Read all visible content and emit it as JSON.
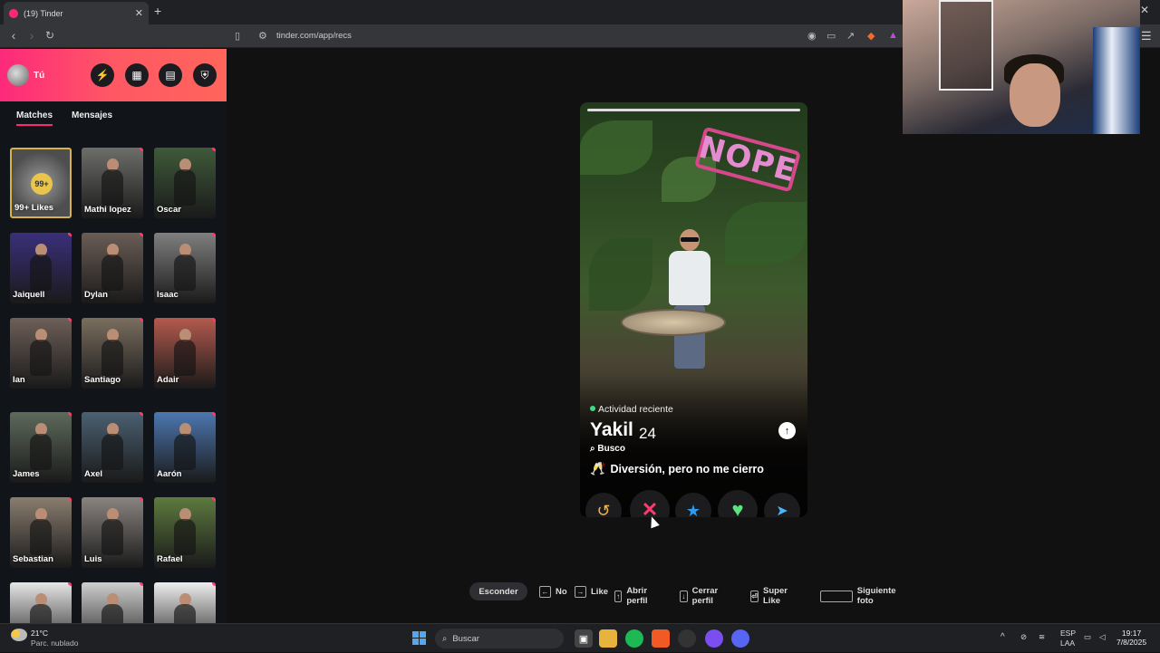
{
  "browser": {
    "tab_title": "(19) Tinder",
    "tab_close": "✕",
    "new_tab": "+",
    "url": "tinder.com/app/recs"
  },
  "sidebar": {
    "user_name": "Tú",
    "tabs": [
      "Matches",
      "Mensajes"
    ],
    "likes_badge": "99+",
    "likes_label": "99+ Likes",
    "matches": [
      {
        "name": "Mathi lopez"
      },
      {
        "name": "Oscar"
      },
      {
        "name": "Jaiquell"
      },
      {
        "name": "Dylan"
      },
      {
        "name": "Isaac"
      },
      {
        "name": "Ian"
      },
      {
        "name": "Santiago"
      },
      {
        "name": "Adair"
      },
      {
        "name": "James"
      },
      {
        "name": "Axel"
      },
      {
        "name": "Aarón"
      },
      {
        "name": "Sebastian"
      },
      {
        "name": "Luis"
      },
      {
        "name": "Rafael"
      },
      {
        "name": ""
      },
      {
        "name": ""
      },
      {
        "name": ""
      }
    ]
  },
  "profile": {
    "stamp": "NOPE",
    "activity": "Actividad reciente",
    "name": "Yakil",
    "age": "24",
    "looking_label": "Busco",
    "intent": "Diversión, pero no me cierro",
    "intent_emoji": "🥂"
  },
  "actions": {
    "rewind": "↺",
    "nope": "✕",
    "superlike": "★",
    "like": "♥",
    "boost": "➤"
  },
  "hints": {
    "hide": "Esconder",
    "no": "No",
    "like": "Like",
    "open_profile": "Abrir perfil",
    "close_profile": "Cerrar perfil",
    "super_like": "Super Like",
    "next_photo": "Siguiente foto"
  },
  "taskbar": {
    "temp": "21°C",
    "weather_desc": "Parc. nublado",
    "search_placeholder": "Buscar",
    "lang_top": "ESP",
    "lang_bottom": "LAA",
    "time": "19:17",
    "date": "7/8/2025"
  },
  "colors": {
    "brand_gradient_start": "#fd297b",
    "brand_gradient_end": "#ff655b",
    "nope": "#fd3c6e",
    "superlike": "#2c9cf0",
    "like": "#5be37d",
    "rewind": "#f5b748",
    "boost": "#4db5f5"
  }
}
